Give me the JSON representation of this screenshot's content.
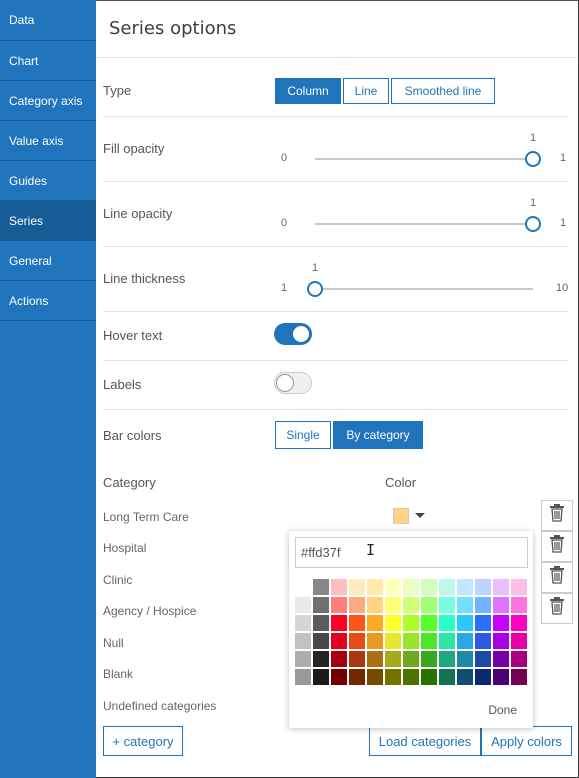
{
  "sidebar": {
    "items": [
      {
        "label": "Data"
      },
      {
        "label": "Chart"
      },
      {
        "label": "Category axis"
      },
      {
        "label": "Value axis"
      },
      {
        "label": "Guides"
      },
      {
        "label": "Series",
        "active": true
      },
      {
        "label": "General"
      },
      {
        "label": "Actions"
      }
    ]
  },
  "panel": {
    "title": "Series options",
    "type": {
      "label": "Type",
      "options": [
        "Column",
        "Line",
        "Smoothed line"
      ],
      "selected": "Column"
    },
    "fill_opacity": {
      "label": "Fill opacity",
      "min": "0",
      "max": "1",
      "value": "1",
      "fraction": 1.0
    },
    "line_opacity": {
      "label": "Line opacity",
      "min": "0",
      "max": "1",
      "value": "1",
      "fraction": 1.0
    },
    "line_thickness": {
      "label": "Line thickness",
      "min": "1",
      "max": "10",
      "value": "1",
      "fraction": 0.0
    },
    "hover_text": {
      "label": "Hover text",
      "on": true
    },
    "labels": {
      "label": "Labels",
      "on": false
    },
    "bar_colors": {
      "label": "Bar colors",
      "options": [
        "Single",
        "By category"
      ],
      "selected": "By category"
    },
    "category_header": "Category",
    "color_header": "Color",
    "categories": [
      "Long Term Care",
      "Hospital",
      "Clinic",
      "Agency / Hospice",
      "Null",
      "Blank",
      "Undefined categories"
    ],
    "first_color": "#ffd37f",
    "add_category": "+ category",
    "load_categories": "Load categories",
    "apply_colors": "Apply colors"
  },
  "color_picker": {
    "hex_value": "#ffd37f",
    "done_label": "Done",
    "palette": [
      [
        null,
        "#888888",
        "#ffbec0",
        "#ffebc2",
        "#ffe9ac",
        "#ffffbe",
        "#e9ffbe",
        "#d3ffbe",
        "#bef8e8",
        "#bee8ff",
        "#bed2ff",
        "#e8beff",
        "#ffbee8"
      ],
      [
        "#e9e9e9",
        "#707070",
        "#ff7f7f",
        "#ffa77f",
        "#ffd37f",
        "#ffff73",
        "#d1ff73",
        "#a3ff73",
        "#73ffdf",
        "#73dfff",
        "#73b2ff",
        "#df73ff",
        "#ff73df"
      ],
      [
        "#d6d6d6",
        "#5c5c5c",
        "#ff0024",
        "#ff5519",
        "#ffaa22",
        "#ffff2a",
        "#aaff2b",
        "#55ff2b",
        "#2bffc8",
        "#2bc8ff",
        "#2b6fff",
        "#c800ff",
        "#ff00c5"
      ],
      [
        "#c2c2c2",
        "#484848",
        "#e60020",
        "#e64c19",
        "#e69a22",
        "#e6e62a",
        "#98e62b",
        "#4ce62b",
        "#2be6a6",
        "#2ba6e6",
        "#2b5ae6",
        "#a600e6",
        "#e600a6"
      ],
      [
        "#adadad",
        "#242424",
        "#a80010",
        "#a83810",
        "#a87010",
        "#a8a820",
        "#70a820",
        "#38a820",
        "#20a880",
        "#2088a8",
        "#1a4aa8",
        "#7800a8",
        "#a80080"
      ],
      [
        "#999999",
        "#1a1a1a",
        "#730000",
        "#732600",
        "#734c00",
        "#737300",
        "#4c7300",
        "#267300",
        "#137350",
        "#104f73",
        "#0b2870",
        "#4c0073",
        "#730050"
      ]
    ]
  },
  "colors": {
    "accent": "#1f74bb",
    "sidebar_bg": "#1f74bb",
    "sidebar_active": "#165d98"
  }
}
